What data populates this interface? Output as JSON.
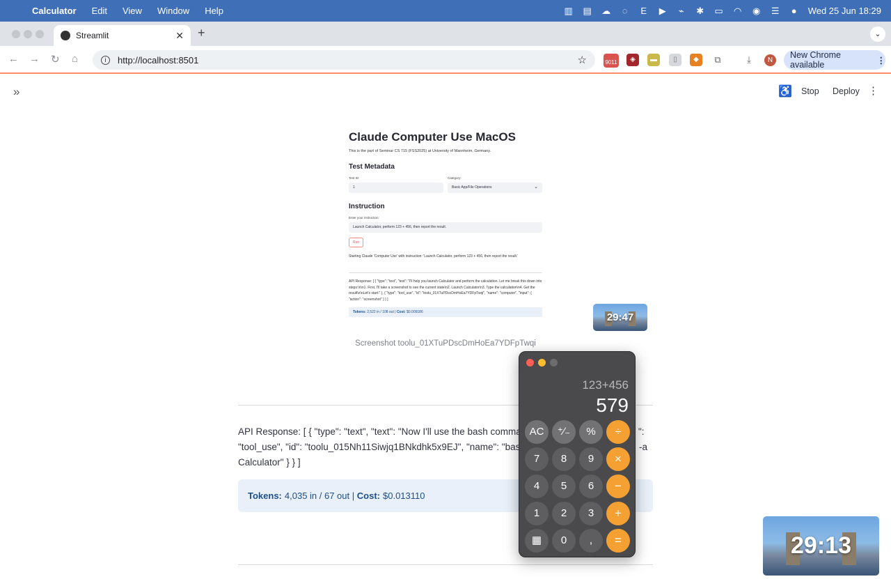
{
  "menubar": {
    "app_name": "Calculator",
    "menus": [
      "Edit",
      "View",
      "Window",
      "Help"
    ],
    "status_letter": "E",
    "clock": "Wed 25 Jun  18:29"
  },
  "browser": {
    "tab_title": "Streamlit",
    "url": "http://localhost:8501",
    "ext_badge": "9011",
    "profile_initial": "N",
    "update_label": "New Chrome available"
  },
  "streamlit": {
    "stop_label": "Stop",
    "deploy_label": "Deploy"
  },
  "screenshot": {
    "title": "Claude Computer Use MacOS",
    "subtitle": "This is the part of Seminar CS 715 (FSS2025) at University of Mannheim, Germany.",
    "metadata_heading": "Test Metadata",
    "test_id_label": "Test ID:",
    "test_id_value": "1",
    "category_label": "Category:",
    "category_value": "Basic App/File Operations",
    "instruction_heading": "Instruction",
    "instruction_label": "Enter your instruction:",
    "instruction_value": "Launch Calculator, perform 123 + 456, then report the result.",
    "run_label": "Run",
    "starting_text": "Starting Claude 'Computer Use' with instruction: 'Launch Calculator, perform 123 + 456, then report the result.'",
    "api_text": "API Response: [ { \"type\": \"text\", \"text\": \"I'll help you launch Calculator and perform the calculation. Let me break this down into steps:\\n\\n1. First, I'll take a screenshot to see the current state\\n2. Launch Calculator\\n3. Type the calculation\\n4. Get the result\\n\\nLet's start:\" }, { \"type\": \"tool_use\", \"id\": \"toolu_01XTuPDscDmHoEa7YDFpTwqi\", \"name\": \"computer\", \"input\": { \"action\": \"screenshot\" } } ]",
    "tokens_label": "Tokens:",
    "tokens_value": "2,522 in / 108 out",
    "cost_label": "Cost:",
    "cost_value": "$0.009186",
    "caption": "Screenshot toolu_01XTuPDscDmHoEa7YDFpTwqi"
  },
  "main": {
    "api_response": "API Response: [ { \"type\": \"text\", \"text\": \"Now I'll use the bash command t",
    "api_response_right": "\":",
    "api_response_line2": "\"tool_use\", \"id\": \"toolu_015Nh11Siwjq1BNkdhk5x9EJ\", \"name\": \"bash\",",
    "api_response_line2_right": "-a",
    "api_response_line3": "Calculator\" } } ]",
    "tokens_label": "Tokens:",
    "tokens_value": "4,035 in / 67 out",
    "separator": "|",
    "cost_label": "Cost:",
    "cost_value": "$0.013110"
  },
  "calculator": {
    "expression": "123+456",
    "result": "579",
    "keys": [
      [
        "AC",
        "⁺∕₋",
        "%",
        "÷"
      ],
      [
        "7",
        "8",
        "9",
        "×"
      ],
      [
        "4",
        "5",
        "6",
        "−"
      ],
      [
        "1",
        "2",
        "3",
        "+"
      ],
      [
        "▦",
        "0",
        ",",
        "="
      ]
    ]
  },
  "pip": {
    "small_timer": "29:47",
    "large_timer": "29:13"
  },
  "colors": {
    "menubar": "#3f6fb6",
    "accent": "#ff4b4b",
    "calc_orange": "#f5a032",
    "tokens_bg": "#e9f0f9"
  }
}
